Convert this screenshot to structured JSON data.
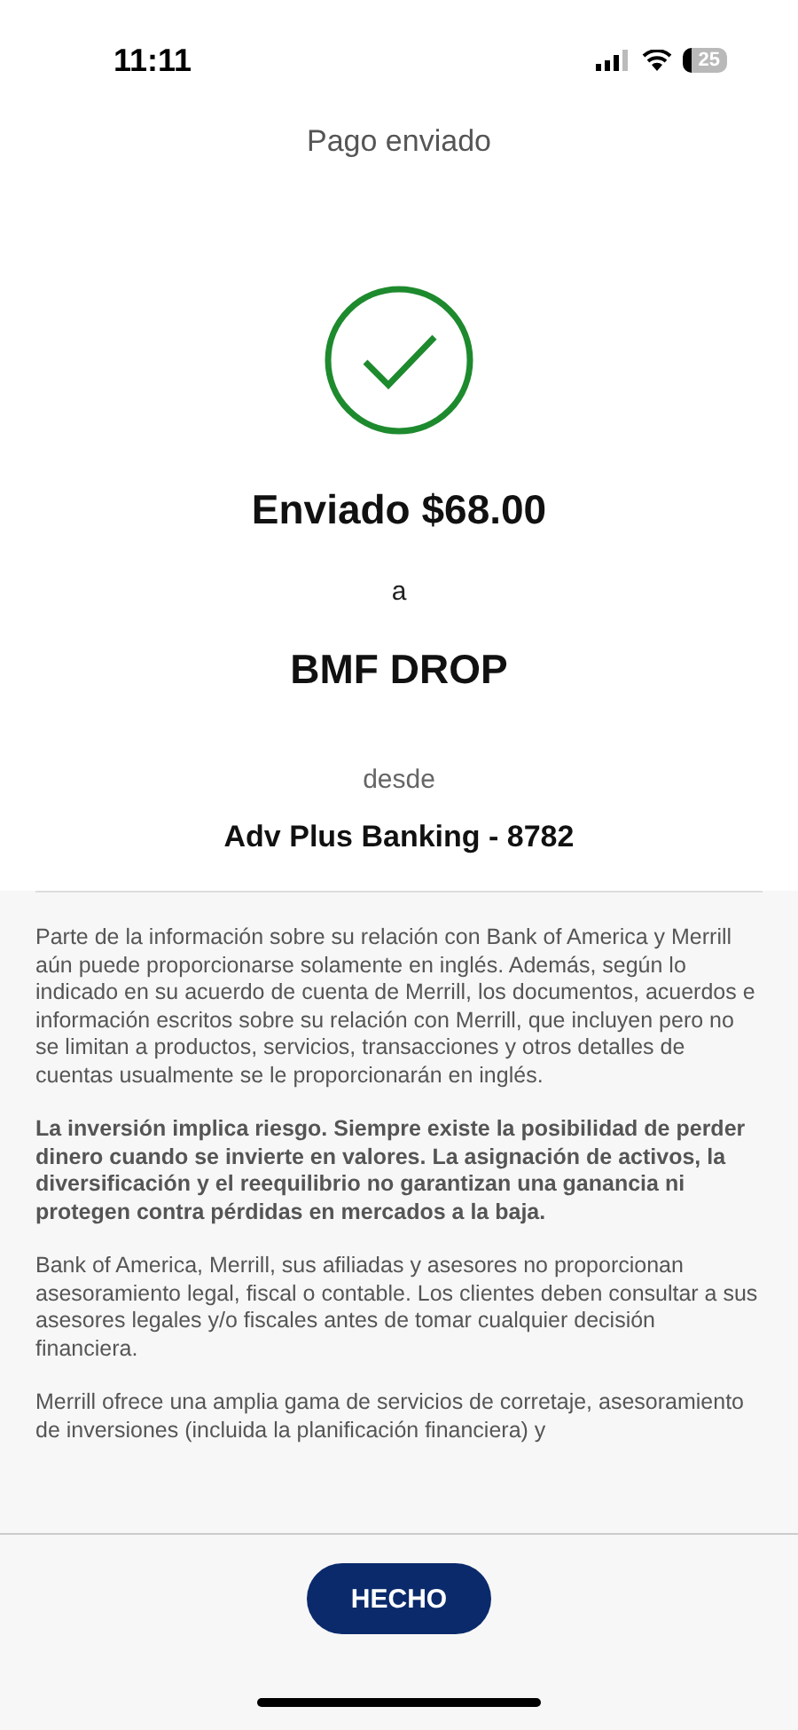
{
  "status_bar": {
    "time": "11:11",
    "battery": "25"
  },
  "title": "Pago enviado",
  "confirmation": {
    "amount_line": "Enviado $68.00",
    "connector": "a",
    "recipient": "BMF DROP",
    "from_label": "desde",
    "account": "Adv Plus Banking - 8782"
  },
  "disclosures": [
    {
      "text": "Parte de la información sobre su relación con Bank of America y Merrill aún puede proporcionarse solamente en inglés. Además, según lo indicado en su acuerdo de cuenta de Merrill, los documentos, acuerdos e información escritos sobre su relación con Merrill, que incluyen pero no se limitan a productos, servicios, transacciones y otros detalles de cuentas usualmente se le proporcionarán en inglés.",
      "bold": false
    },
    {
      "text": "La inversión implica riesgo. Siempre existe la posibilidad de perder dinero cuando se invierte en valores. La asignación de activos, la diversificación y el reequilibrio no garantizan una ganancia ni protegen contra pérdidas en mercados a la baja.",
      "bold": true
    },
    {
      "text": "Bank of America, Merrill, sus afiliadas y asesores no proporcionan asesoramiento legal, fiscal o contable. Los clientes deben consultar a sus asesores legales y/o fiscales antes de tomar cualquier decisión financiera.",
      "bold": false
    },
    {
      "text": "Merrill ofrece una amplia gama de servicios de corretaje, asesoramiento de inversiones (incluida la planificación financiera) y",
      "bold": false
    }
  ],
  "done_button": "HECHO"
}
